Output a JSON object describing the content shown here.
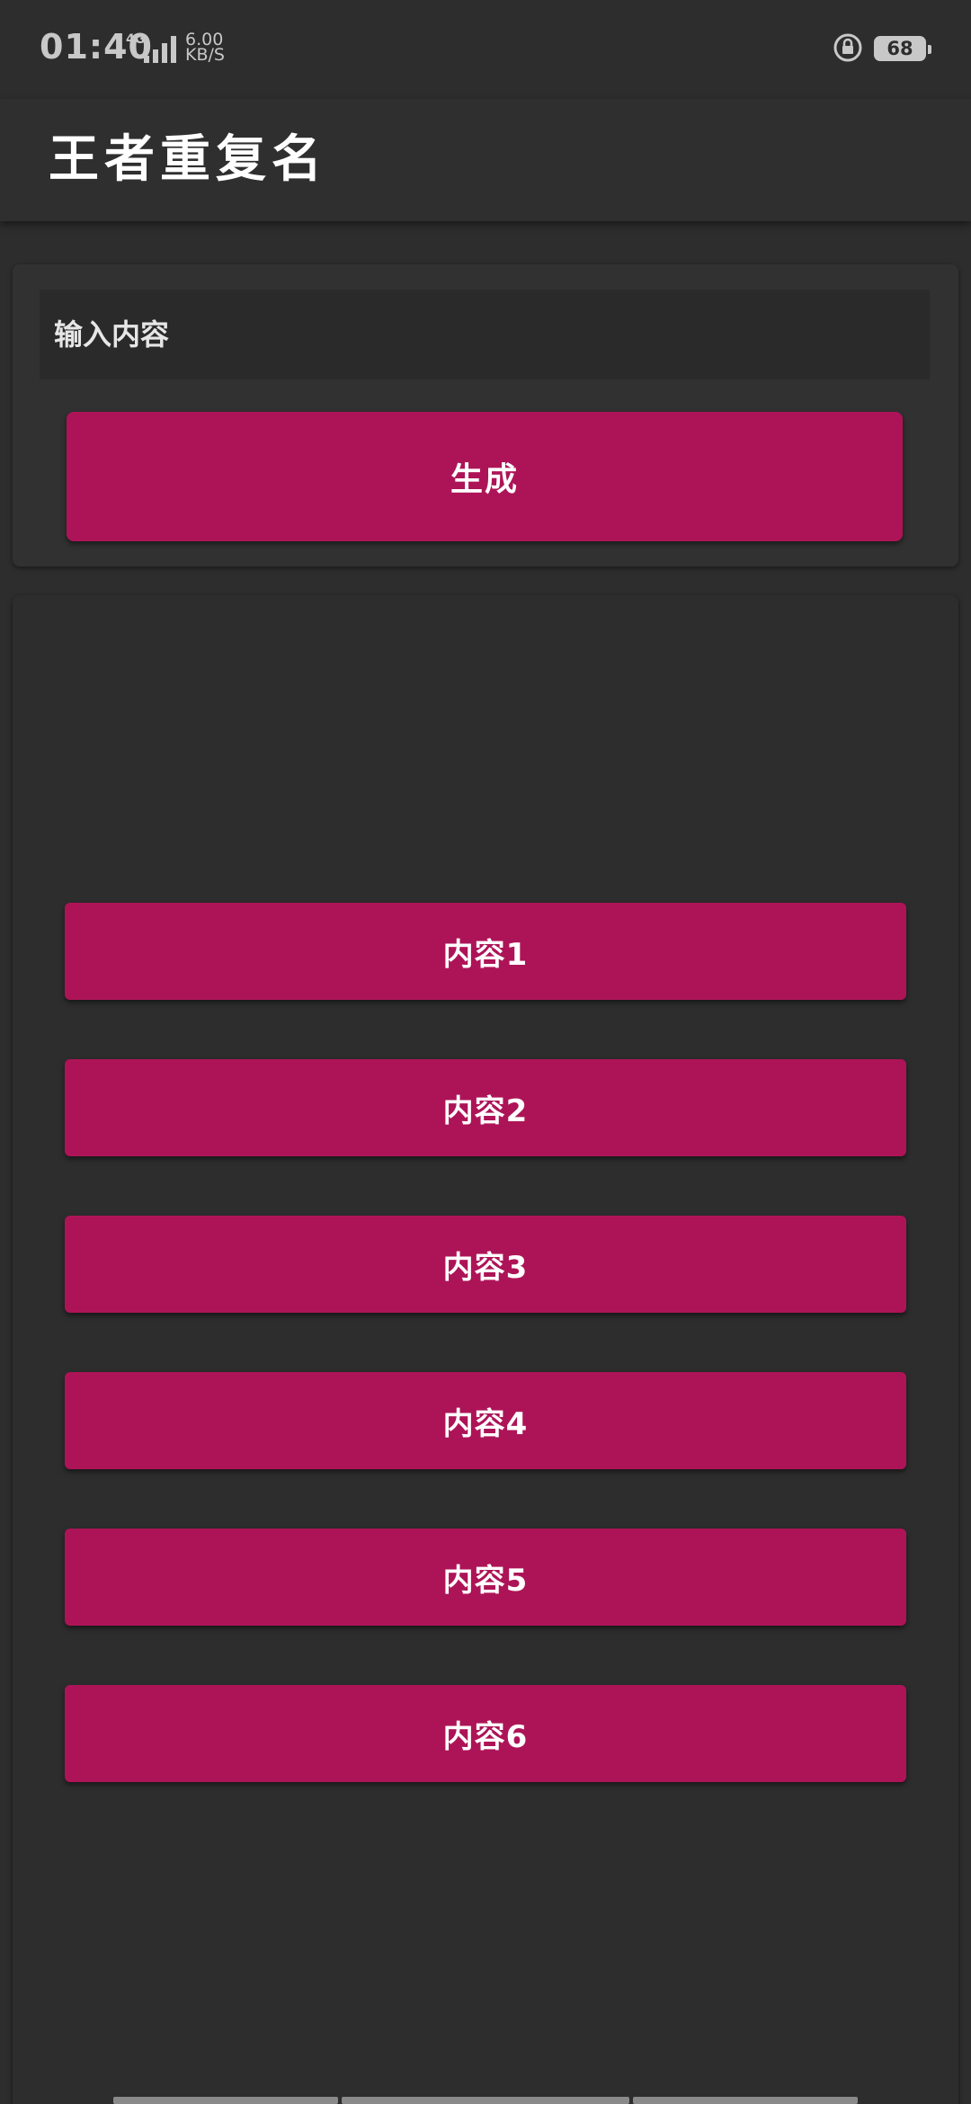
{
  "status_bar": {
    "time": "01:40",
    "network_type": "4G",
    "net_speed_value": "6.00",
    "net_speed_unit": "KB/S",
    "battery_level": "68",
    "icons": [
      "signal-icon",
      "rotation-lock-icon",
      "battery-icon"
    ]
  },
  "app_bar": {
    "title": "王者重复名"
  },
  "input_card": {
    "placeholder": "输入内容",
    "generate_label": "生成"
  },
  "results": {
    "items": [
      {
        "label": "内容1"
      },
      {
        "label": "内容2"
      },
      {
        "label": "内容3"
      },
      {
        "label": "内容4"
      },
      {
        "label": "内容5"
      },
      {
        "label": "内容6"
      }
    ]
  },
  "colors": {
    "accent": "#ad1457",
    "background": "#2d2d2d",
    "card": "#313131",
    "input": "#2a2a2a"
  }
}
